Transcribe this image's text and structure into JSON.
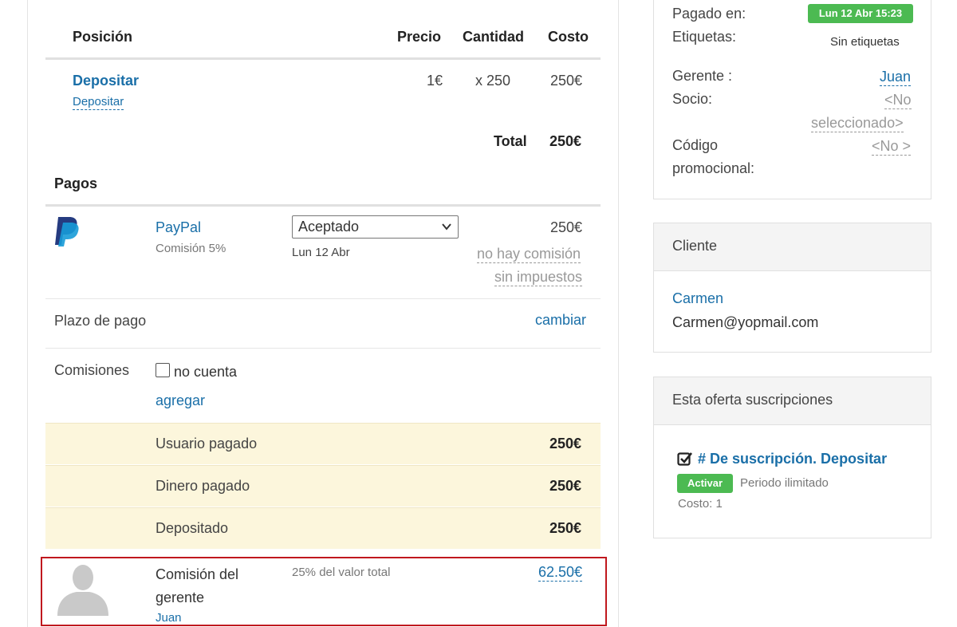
{
  "order_table": {
    "headers": {
      "position": "Posición",
      "price": "Precio",
      "quantity": "Cantidad",
      "cost": "Costo"
    },
    "item": {
      "name": "Depositar",
      "subname": "Depositar",
      "price": "1€",
      "quantity": "x 250",
      "cost": "250€"
    },
    "total_label": "Total",
    "total_value": "250€"
  },
  "payments": {
    "title": "Pagos",
    "method": "PayPal",
    "commission": "Comisión 5%",
    "status_selected": "Aceptado",
    "date": "Lun 12 Abr",
    "amount": "250€",
    "no_commission": "no hay comisión",
    "no_tax": "sin impuestos"
  },
  "payment_term": {
    "label": "Plazo de pago",
    "action": "cambiar"
  },
  "commissions": {
    "label": "Comisiones",
    "checkbox_label": "no cuenta",
    "add_label": "agregar"
  },
  "summary_rows": [
    {
      "label": "Usuario pagado",
      "value": "250€"
    },
    {
      "label": "Dinero pagado",
      "value": "250€"
    },
    {
      "label": "Depositado",
      "value": "250€"
    }
  ],
  "manager_commission": {
    "title": "Comisión del gerente",
    "description": "25% del valor total",
    "amount": "62.50€",
    "manager": "Juan"
  },
  "order_info": {
    "paid_at_label": "Pagado en:",
    "paid_at_value": "Lun 12 Abr 15:23",
    "tags_label": "Etiquetas:",
    "tags_value": "Sin etiquetas",
    "manager_label": "Gerente :",
    "manager_value": "Juan",
    "partner_label": "Socio:",
    "partner_value_line1": "<No",
    "partner_value_line2": "seleccionado>",
    "promo_label_line1": "Código",
    "promo_label_line2": "promocional:",
    "promo_value": "<No >"
  },
  "client": {
    "title": "Cliente",
    "name": "Carmen",
    "email": "Carmen@yopmail.com"
  },
  "subscriptions": {
    "title": "Esta oferta suscripciones",
    "item_title": "# De suscripción. Depositar",
    "status": "Activar",
    "period": "Periodo ilimitado",
    "cost": "Costo: 1"
  },
  "colors": {
    "link": "#1a6fa8",
    "active_badge": "#4cba52",
    "highlight_row": "#fcf6dc",
    "highlight_border": "#c0181e"
  }
}
